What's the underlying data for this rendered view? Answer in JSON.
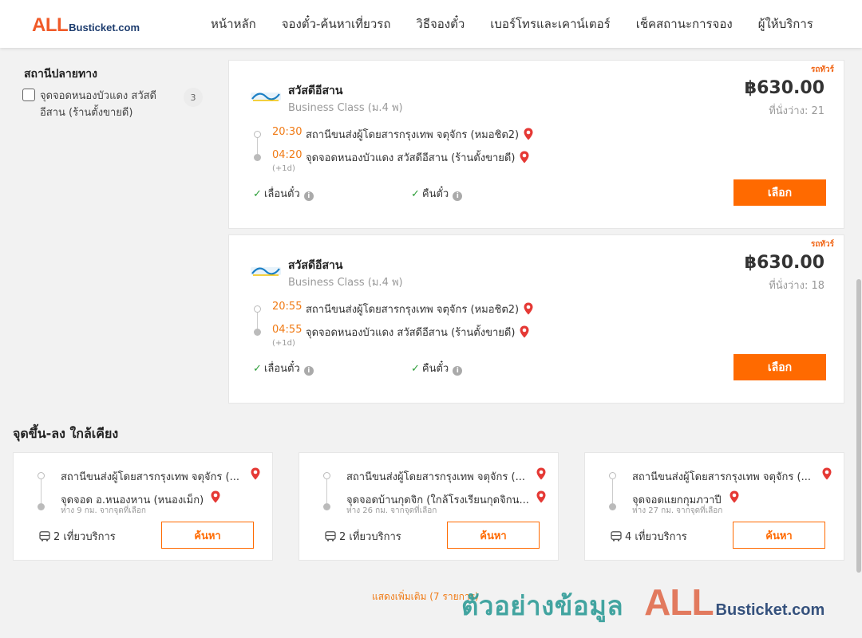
{
  "header": {
    "logo_all": "ALL",
    "logo_suffix": "Busticket.com",
    "nav": [
      "หน้าหลัก",
      "จองตั๋ว-ค้นหาเที่ยวรถ",
      "วิธีจองตั๋ว",
      "เบอร์โทรและเคาน์เตอร์",
      "เช็คสถานะการจอง",
      "ผู้ให้บริการ"
    ]
  },
  "sidebar": {
    "filter_title": "สถานีปลายทาง",
    "filter_item": {
      "label": "จุดจอดหนองบัวแดง สวัสดีอีสาน (ร้านตั้งขายดี)",
      "count": "3",
      "checked": false
    }
  },
  "trips": [
    {
      "tag": "รถทัวร์",
      "operator": "สวัสดีอีสาน",
      "bus_class": "Business Class (ม.4 พ)",
      "price": "฿630.00",
      "seats": "ที่นั่งว่าง: 21",
      "depart_time": "20:30",
      "depart_station": "สถานีขนส่งผู้โดยสารกรุงเทพ จตุจักร (หมอชิต2)",
      "arrive_time": "04:20",
      "arrive_station": "จุดจอดหนองบัวแดง สวัสดีอีสาน (ร้านตั้งขายดี)",
      "next_day": "(+1d)",
      "feature_1": "เลื่อนตั๋ว",
      "feature_2": "คืนตั๋ว",
      "button": "เลือก"
    },
    {
      "tag": "รถทัวร์",
      "operator": "สวัสดีอีสาน",
      "bus_class": "Business Class (ม.4 พ)",
      "price": "฿630.00",
      "seats": "ที่นั่งว่าง: 18",
      "depart_time": "20:55",
      "depart_station": "สถานีขนส่งผู้โดยสารกรุงเทพ จตุจักร (หมอชิต2)",
      "arrive_time": "04:55",
      "arrive_station": "จุดจอดหนองบัวแดง สวัสดีอีสาน (ร้านตั้งขายดี)",
      "next_day": "(+1d)",
      "feature_1": "เลื่อนตั๋ว",
      "feature_2": "คืนตั๋ว",
      "button": "เลือก"
    }
  ],
  "nearby": {
    "title": "จุดขึ้น-ลง ใกล้เคียง",
    "cards": [
      {
        "from": "สถานีขนส่งผู้โดยสารกรุงเทพ จตุจักร (...",
        "to": "จุดจอด อ.หนองหาน (หนองเม็ก)",
        "distance": "ห่าง 9 กม. จากจุดที่เลือก",
        "trips": "2 เที่ยวบริการ",
        "button": "ค้นหา"
      },
      {
        "from": "สถานีขนส่งผู้โดยสารกรุงเทพ จตุจักร (...",
        "to": "จุดจอดบ้านกุดจิก (ใกล้โรงเรียนกุดจิกน...",
        "distance": "ห่าง 26 กม. จากจุดที่เลือก",
        "trips": "2 เที่ยวบริการ",
        "button": "ค้นหา"
      },
      {
        "from": "สถานีขนส่งผู้โดยสารกรุงเทพ จตุจักร (...",
        "to": "จุดจอดแยกกุมภวาปี",
        "distance": "ห่าง 27 กม. จากจุดที่เลือก",
        "trips": "4 เที่ยวบริการ",
        "button": "ค้นหา"
      }
    ],
    "show_more": "แสดงเพิ่มเติม (7 รายการ)"
  },
  "watermark": {
    "text": "ตัวอย่างข้อมูล",
    "all": "ALL",
    "suffix": "Busticket.com"
  },
  "colors": {
    "accent": "#ff6a00",
    "time": "#f07a14",
    "check": "#2e9e3a",
    "pin": "#e53935",
    "logo_orange": "#f05a28",
    "logo_navy": "#1d3c6e"
  }
}
